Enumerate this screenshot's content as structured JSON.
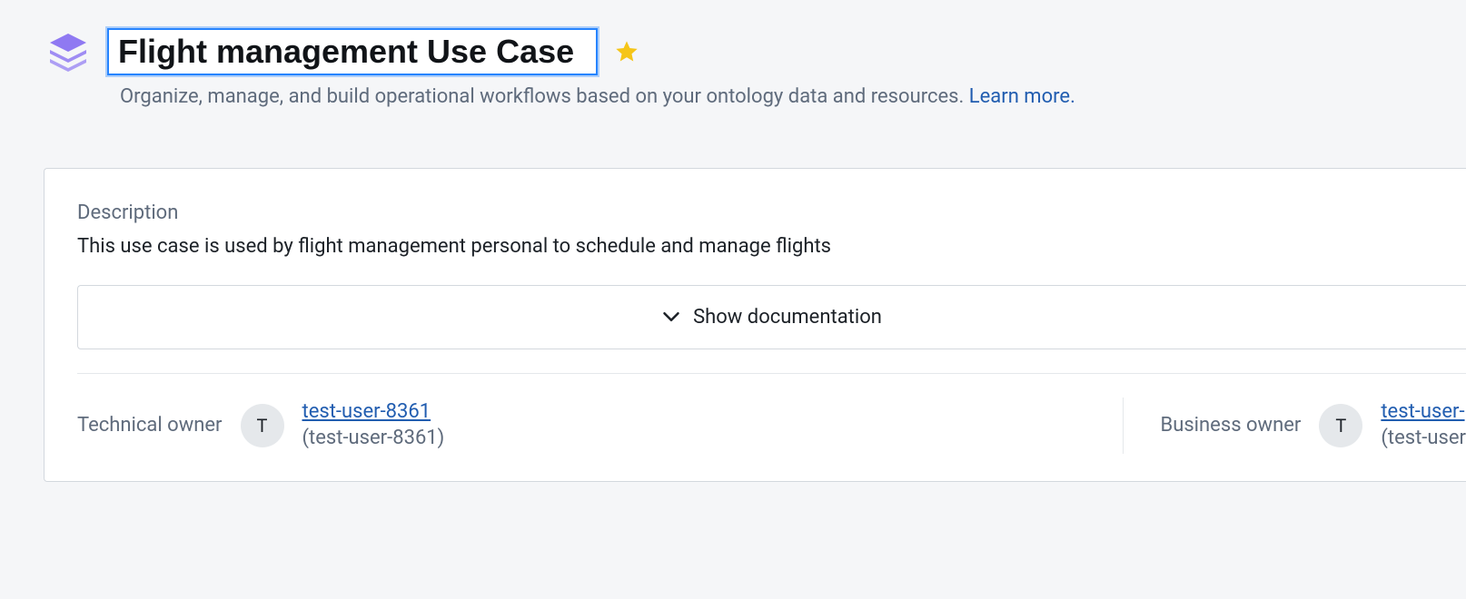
{
  "header": {
    "title_value": "Flight management Use Case",
    "subtitle_text": "Organize, manage, and build operational workflows based on your ontology data and resources. ",
    "learn_more_label": "Learn more."
  },
  "card": {
    "description_label": "Description",
    "description_text": "This use case is used by flight management personal to schedule and manage flights",
    "show_documentation_label": "Show documentation",
    "technical_owner": {
      "label": "Technical owner",
      "avatar_initial": "T",
      "name": "test-user-8361",
      "handle": "(test-user-8361)"
    },
    "business_owner": {
      "label": "Business owner",
      "avatar_initial": "T",
      "name": "test-user-",
      "handle": "(test-user"
    }
  }
}
